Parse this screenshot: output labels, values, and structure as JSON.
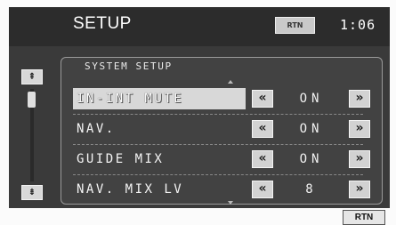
{
  "header": {
    "title": "SETUP",
    "rtn_label": "RTN",
    "clock": "1:06"
  },
  "panel": {
    "title": "SYSTEM SETUP",
    "rows": [
      {
        "label": "IN-INT MUTE",
        "value": "ON",
        "selected": true
      },
      {
        "label": "NAV.",
        "value": "ON",
        "selected": false
      },
      {
        "label": "GUIDE MIX",
        "value": "ON",
        "selected": false
      },
      {
        "label": "NAV. MIX LV",
        "value": "8",
        "selected": false
      }
    ]
  },
  "icons": {
    "scroll_up": "double-up-arrow-icon",
    "scroll_down": "double-down-arrow-icon",
    "decrease": "double-left-chevron-icon",
    "increase": "double-right-chevron-icon"
  },
  "footer": {
    "rtn_label": "RTN"
  }
}
